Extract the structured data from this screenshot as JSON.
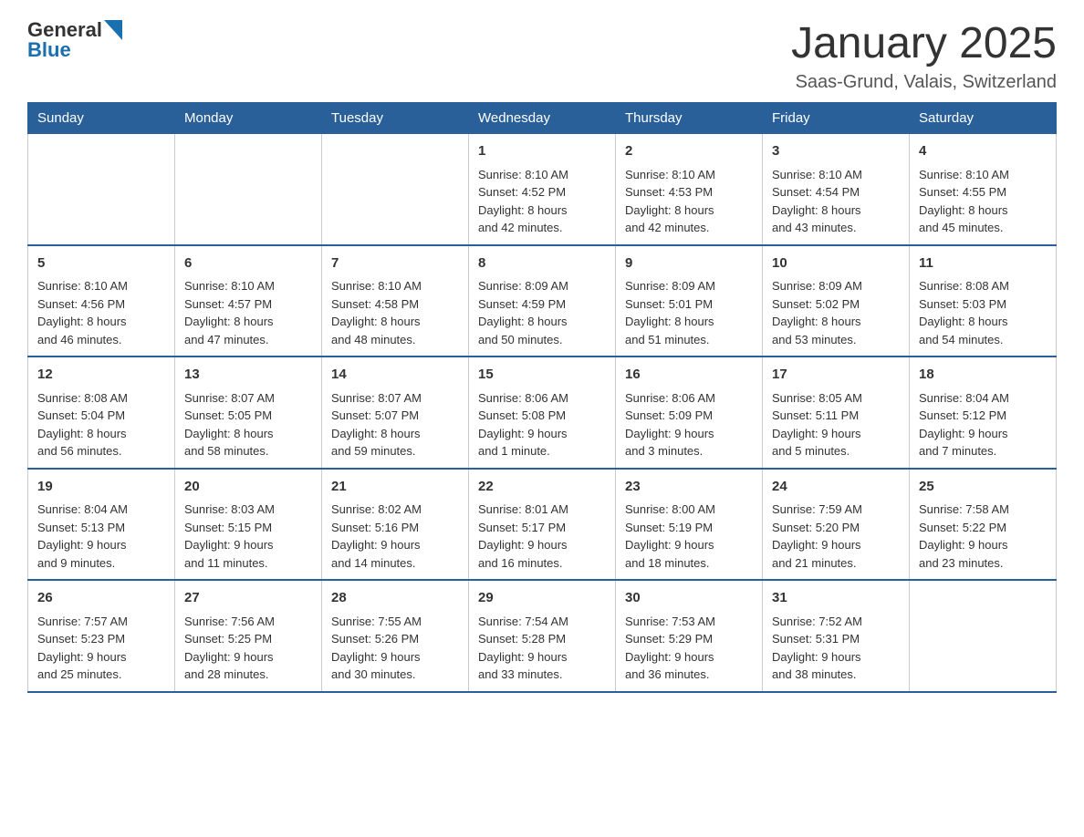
{
  "header": {
    "logo": {
      "general": "General",
      "blue": "Blue"
    },
    "title": "January 2025",
    "location": "Saas-Grund, Valais, Switzerland"
  },
  "days_of_week": [
    "Sunday",
    "Monday",
    "Tuesday",
    "Wednesday",
    "Thursday",
    "Friday",
    "Saturday"
  ],
  "weeks": [
    [
      {
        "day": "",
        "info": ""
      },
      {
        "day": "",
        "info": ""
      },
      {
        "day": "",
        "info": ""
      },
      {
        "day": "1",
        "info": "Sunrise: 8:10 AM\nSunset: 4:52 PM\nDaylight: 8 hours\nand 42 minutes."
      },
      {
        "day": "2",
        "info": "Sunrise: 8:10 AM\nSunset: 4:53 PM\nDaylight: 8 hours\nand 42 minutes."
      },
      {
        "day": "3",
        "info": "Sunrise: 8:10 AM\nSunset: 4:54 PM\nDaylight: 8 hours\nand 43 minutes."
      },
      {
        "day": "4",
        "info": "Sunrise: 8:10 AM\nSunset: 4:55 PM\nDaylight: 8 hours\nand 45 minutes."
      }
    ],
    [
      {
        "day": "5",
        "info": "Sunrise: 8:10 AM\nSunset: 4:56 PM\nDaylight: 8 hours\nand 46 minutes."
      },
      {
        "day": "6",
        "info": "Sunrise: 8:10 AM\nSunset: 4:57 PM\nDaylight: 8 hours\nand 47 minutes."
      },
      {
        "day": "7",
        "info": "Sunrise: 8:10 AM\nSunset: 4:58 PM\nDaylight: 8 hours\nand 48 minutes."
      },
      {
        "day": "8",
        "info": "Sunrise: 8:09 AM\nSunset: 4:59 PM\nDaylight: 8 hours\nand 50 minutes."
      },
      {
        "day": "9",
        "info": "Sunrise: 8:09 AM\nSunset: 5:01 PM\nDaylight: 8 hours\nand 51 minutes."
      },
      {
        "day": "10",
        "info": "Sunrise: 8:09 AM\nSunset: 5:02 PM\nDaylight: 8 hours\nand 53 minutes."
      },
      {
        "day": "11",
        "info": "Sunrise: 8:08 AM\nSunset: 5:03 PM\nDaylight: 8 hours\nand 54 minutes."
      }
    ],
    [
      {
        "day": "12",
        "info": "Sunrise: 8:08 AM\nSunset: 5:04 PM\nDaylight: 8 hours\nand 56 minutes."
      },
      {
        "day": "13",
        "info": "Sunrise: 8:07 AM\nSunset: 5:05 PM\nDaylight: 8 hours\nand 58 minutes."
      },
      {
        "day": "14",
        "info": "Sunrise: 8:07 AM\nSunset: 5:07 PM\nDaylight: 8 hours\nand 59 minutes."
      },
      {
        "day": "15",
        "info": "Sunrise: 8:06 AM\nSunset: 5:08 PM\nDaylight: 9 hours\nand 1 minute."
      },
      {
        "day": "16",
        "info": "Sunrise: 8:06 AM\nSunset: 5:09 PM\nDaylight: 9 hours\nand 3 minutes."
      },
      {
        "day": "17",
        "info": "Sunrise: 8:05 AM\nSunset: 5:11 PM\nDaylight: 9 hours\nand 5 minutes."
      },
      {
        "day": "18",
        "info": "Sunrise: 8:04 AM\nSunset: 5:12 PM\nDaylight: 9 hours\nand 7 minutes."
      }
    ],
    [
      {
        "day": "19",
        "info": "Sunrise: 8:04 AM\nSunset: 5:13 PM\nDaylight: 9 hours\nand 9 minutes."
      },
      {
        "day": "20",
        "info": "Sunrise: 8:03 AM\nSunset: 5:15 PM\nDaylight: 9 hours\nand 11 minutes."
      },
      {
        "day": "21",
        "info": "Sunrise: 8:02 AM\nSunset: 5:16 PM\nDaylight: 9 hours\nand 14 minutes."
      },
      {
        "day": "22",
        "info": "Sunrise: 8:01 AM\nSunset: 5:17 PM\nDaylight: 9 hours\nand 16 minutes."
      },
      {
        "day": "23",
        "info": "Sunrise: 8:00 AM\nSunset: 5:19 PM\nDaylight: 9 hours\nand 18 minutes."
      },
      {
        "day": "24",
        "info": "Sunrise: 7:59 AM\nSunset: 5:20 PM\nDaylight: 9 hours\nand 21 minutes."
      },
      {
        "day": "25",
        "info": "Sunrise: 7:58 AM\nSunset: 5:22 PM\nDaylight: 9 hours\nand 23 minutes."
      }
    ],
    [
      {
        "day": "26",
        "info": "Sunrise: 7:57 AM\nSunset: 5:23 PM\nDaylight: 9 hours\nand 25 minutes."
      },
      {
        "day": "27",
        "info": "Sunrise: 7:56 AM\nSunset: 5:25 PM\nDaylight: 9 hours\nand 28 minutes."
      },
      {
        "day": "28",
        "info": "Sunrise: 7:55 AM\nSunset: 5:26 PM\nDaylight: 9 hours\nand 30 minutes."
      },
      {
        "day": "29",
        "info": "Sunrise: 7:54 AM\nSunset: 5:28 PM\nDaylight: 9 hours\nand 33 minutes."
      },
      {
        "day": "30",
        "info": "Sunrise: 7:53 AM\nSunset: 5:29 PM\nDaylight: 9 hours\nand 36 minutes."
      },
      {
        "day": "31",
        "info": "Sunrise: 7:52 AM\nSunset: 5:31 PM\nDaylight: 9 hours\nand 38 minutes."
      },
      {
        "day": "",
        "info": ""
      }
    ]
  ]
}
